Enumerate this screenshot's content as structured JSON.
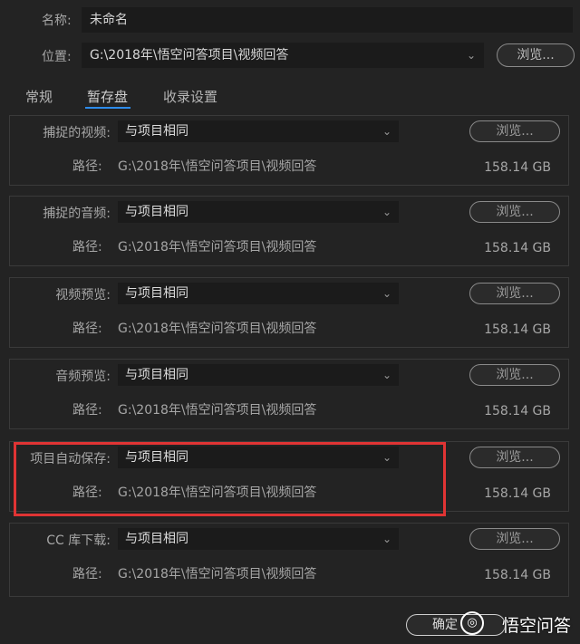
{
  "top": {
    "name_label": "名称:",
    "name_value": "未命名",
    "location_label": "位置:",
    "location_value": "G:\\2018年\\悟空问答项目\\视频回答",
    "browse": "浏览..."
  },
  "tabs": [
    {
      "label": "常规"
    },
    {
      "label": "暂存盘"
    },
    {
      "label": "收录设置"
    }
  ],
  "sections": [
    {
      "label": "捕捉的视频:",
      "select": "与项目相同",
      "browse": "浏览...",
      "path_label": "路径:",
      "path": "G:\\2018年\\悟空问答项目\\视频回答",
      "size": "158.14 GB"
    },
    {
      "label": "捕捉的音频:",
      "select": "与项目相同",
      "browse": "浏览...",
      "path_label": "路径:",
      "path": "G:\\2018年\\悟空问答项目\\视频回答",
      "size": "158.14 GB"
    },
    {
      "label": "视频预览:",
      "select": "与项目相同",
      "browse": "浏览...",
      "path_label": "路径:",
      "path": "G:\\2018年\\悟空问答项目\\视频回答",
      "size": "158.14 GB"
    },
    {
      "label": "音频预览:",
      "select": "与项目相同",
      "browse": "浏览...",
      "path_label": "路径:",
      "path": "G:\\2018年\\悟空问答项目\\视频回答",
      "size": "158.14 GB"
    },
    {
      "label": "项目自动保存:",
      "select": "与项目相同",
      "browse": "浏览...",
      "path_label": "路径:",
      "path": "G:\\2018年\\悟空问答项目\\视频回答",
      "size": "158.14 GB"
    },
    {
      "label": "CC 库下载:",
      "select": "与项目相同",
      "browse": "浏览...",
      "path_label": "路径:",
      "path": "G:\\2018年\\悟空问答项目\\视频回答",
      "size": "158.14 GB"
    }
  ],
  "footer": {
    "ok": "确定",
    "watermark": "悟空问答"
  },
  "colors": {
    "accent": "#2d8ceb",
    "highlight": "#e03434",
    "background": "#232323"
  }
}
